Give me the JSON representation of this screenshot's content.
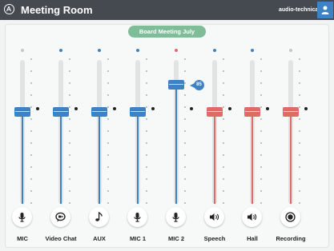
{
  "window": {
    "title": "Meeting Room",
    "brand": "audio-technica"
  },
  "preset": {
    "name": "Board Meeting July"
  },
  "colors": {
    "blue": "#3e82c4",
    "red": "#df6b69",
    "grey_dot": "#c4c8c6",
    "titlebar": "#454950",
    "preset": "#7ebd97"
  },
  "channels": [
    {
      "label": "MIC",
      "icon": "microphone-icon",
      "color": "blue",
      "status_dot": "grey_dot",
      "level": 0.65,
      "value": ""
    },
    {
      "label": "Video Chat",
      "icon": "video-chat-icon",
      "color": "blue",
      "status_dot": "blue",
      "level": 0.65,
      "value": ""
    },
    {
      "label": "AUX",
      "icon": "music-note-icon",
      "color": "blue",
      "status_dot": "blue",
      "level": 0.65,
      "value": ""
    },
    {
      "label": "MIC 1",
      "icon": "microphone-icon",
      "color": "blue",
      "status_dot": "blue",
      "level": 0.65,
      "value": ""
    },
    {
      "label": "MIC 2",
      "icon": "microphone-icon",
      "color": "blue",
      "status_dot": "red",
      "level": 0.85,
      "value": "85"
    },
    {
      "label": "Speech",
      "icon": "speaker-icon",
      "color": "red",
      "status_dot": "blue",
      "level": 0.65,
      "value": ""
    },
    {
      "label": "Hall",
      "icon": "speaker-icon",
      "color": "red",
      "status_dot": "blue",
      "level": 0.65,
      "value": ""
    },
    {
      "label": "Recording",
      "icon": "record-icon",
      "color": "red",
      "status_dot": "grey_dot",
      "level": 0.65,
      "value": ""
    }
  ]
}
